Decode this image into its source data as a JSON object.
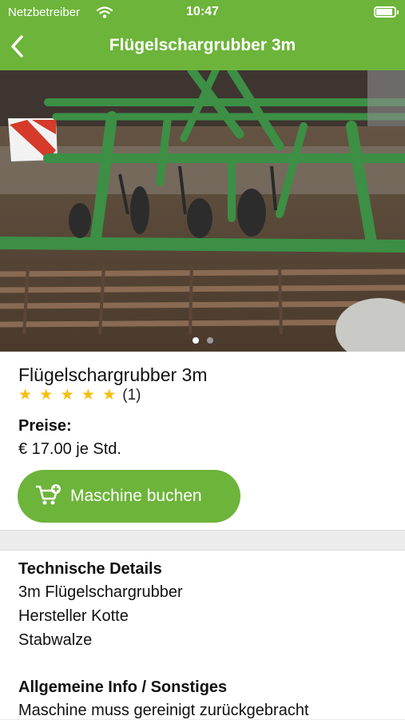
{
  "status_bar": {
    "carrier": "Netzbetreiber",
    "time": "10:47",
    "battery_level": 0.9
  },
  "nav": {
    "title": "Flügelschargrubber 3m"
  },
  "carousel": {
    "page_count": 2,
    "current_page": 1
  },
  "machine": {
    "name": "Flügelschargrubber 3m",
    "rating_stars": "★ ★ ★ ★ ★",
    "rating_value": 5,
    "review_count": "(1)",
    "price_label": "Preise:",
    "price": "€ 17.00 je Std.",
    "book_label": "Maschine buchen"
  },
  "details": {
    "technical_title": "Technische Details",
    "technical_lines": [
      "3m Flügelschargrubber",
      "Hersteller Kotte",
      "Stabwalze"
    ],
    "general_title": "Allgemeine Info / Sonstiges",
    "general_lines": [
      "Maschine muss gereinigt zurückgebracht"
    ]
  },
  "colors": {
    "brand_green": "#6db43a",
    "star": "#f5bf0a",
    "implement_green": "#3c8f45"
  }
}
